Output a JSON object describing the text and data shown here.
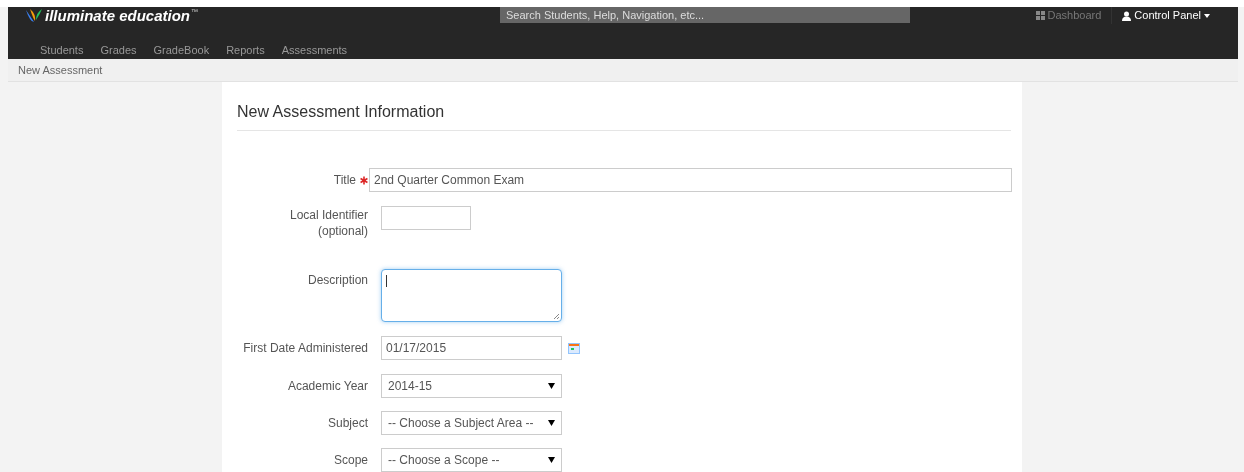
{
  "brand": {
    "name": "illuminate education",
    "mark": "™"
  },
  "search": {
    "placeholder": "Search Students, Help, Navigation, etc..."
  },
  "top_links": [
    {
      "kind": "dashboard",
      "label": "Dashboard"
    },
    {
      "kind": "user",
      "label": "Control Panel"
    }
  ],
  "nav": [
    {
      "label": "Students"
    },
    {
      "label": "Grades"
    },
    {
      "label": "GradeBook"
    },
    {
      "label": "Reports"
    },
    {
      "label": "Assessments"
    }
  ],
  "breadcrumb": "New Assessment",
  "form": {
    "heading": "New Assessment Information",
    "fields": [
      {
        "kind": "text",
        "label": "Title",
        "required": true,
        "focused": false,
        "value": "2nd Quarter Common Exam"
      },
      {
        "kind": "short_text",
        "label": "Local Identifier",
        "sublabel": "(optional)",
        "required": false,
        "focused": false
      },
      {
        "kind": "textarea",
        "label": "Description",
        "required": false,
        "focused": true
      },
      {
        "kind": "date",
        "label": "First Date Administered",
        "required": false,
        "focused": false,
        "value": "01/17/2015"
      },
      {
        "kind": "select",
        "label": "Academic Year",
        "required": false,
        "focused": false,
        "value": "2014-15"
      },
      {
        "kind": "select",
        "label": "Subject",
        "required": false,
        "focused": false,
        "value": "-- Choose a Subject Area --"
      },
      {
        "kind": "select",
        "label": "Scope",
        "required": false,
        "focused": false,
        "value": "-- Choose a Scope --"
      }
    ]
  }
}
